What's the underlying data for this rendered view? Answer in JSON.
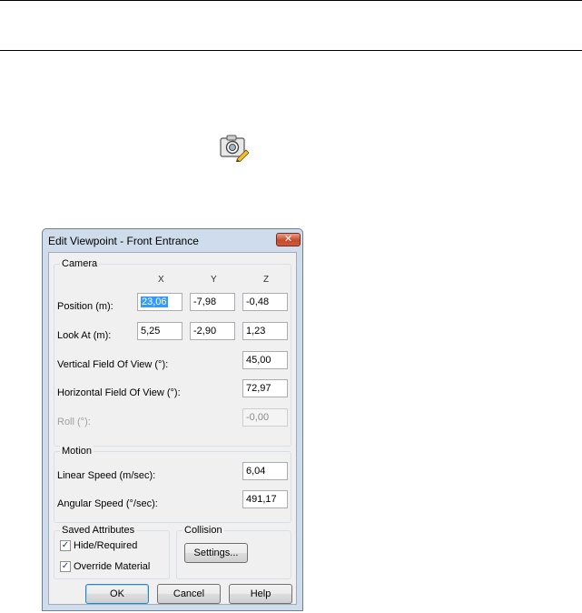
{
  "icon": "camera-edit-icon",
  "dialog": {
    "title": "Edit Viewpoint - Front Entrance",
    "close_glyph": "✕",
    "camera": {
      "legend": "Camera",
      "col_x": "X",
      "col_y": "Y",
      "col_z": "Z",
      "position_label": "Position (m):",
      "position_x": "23,06",
      "position_y": "-7,98",
      "position_z": "-0,48",
      "look_at_label": "Look At (m):",
      "look_at_x": "5,25",
      "look_at_y": "-2,90",
      "look_at_z": "1,23",
      "vfov_label": "Vertical Field Of View (°):",
      "vfov_value": "45,00",
      "hfov_label": "Horizontal Field Of View (°):",
      "hfov_value": "72,97",
      "roll_label": "Roll (°):",
      "roll_value": "-0,00"
    },
    "motion": {
      "legend": "Motion",
      "linear_label": "Linear Speed (m/sec):",
      "linear_value": "6,04",
      "angular_label": "Angular Speed (°/sec):",
      "angular_value": "491,17"
    },
    "saved_attributes": {
      "legend": "Saved Attributes",
      "hide_required_label": "Hide/Required",
      "hide_required_checked": true,
      "override_material_label": "Override Material",
      "override_material_checked": true,
      "check_glyph": "✓"
    },
    "collision": {
      "legend": "Collision",
      "settings_button": "Settings..."
    },
    "buttons": {
      "ok": "OK",
      "cancel": "Cancel",
      "help": "Help"
    }
  }
}
